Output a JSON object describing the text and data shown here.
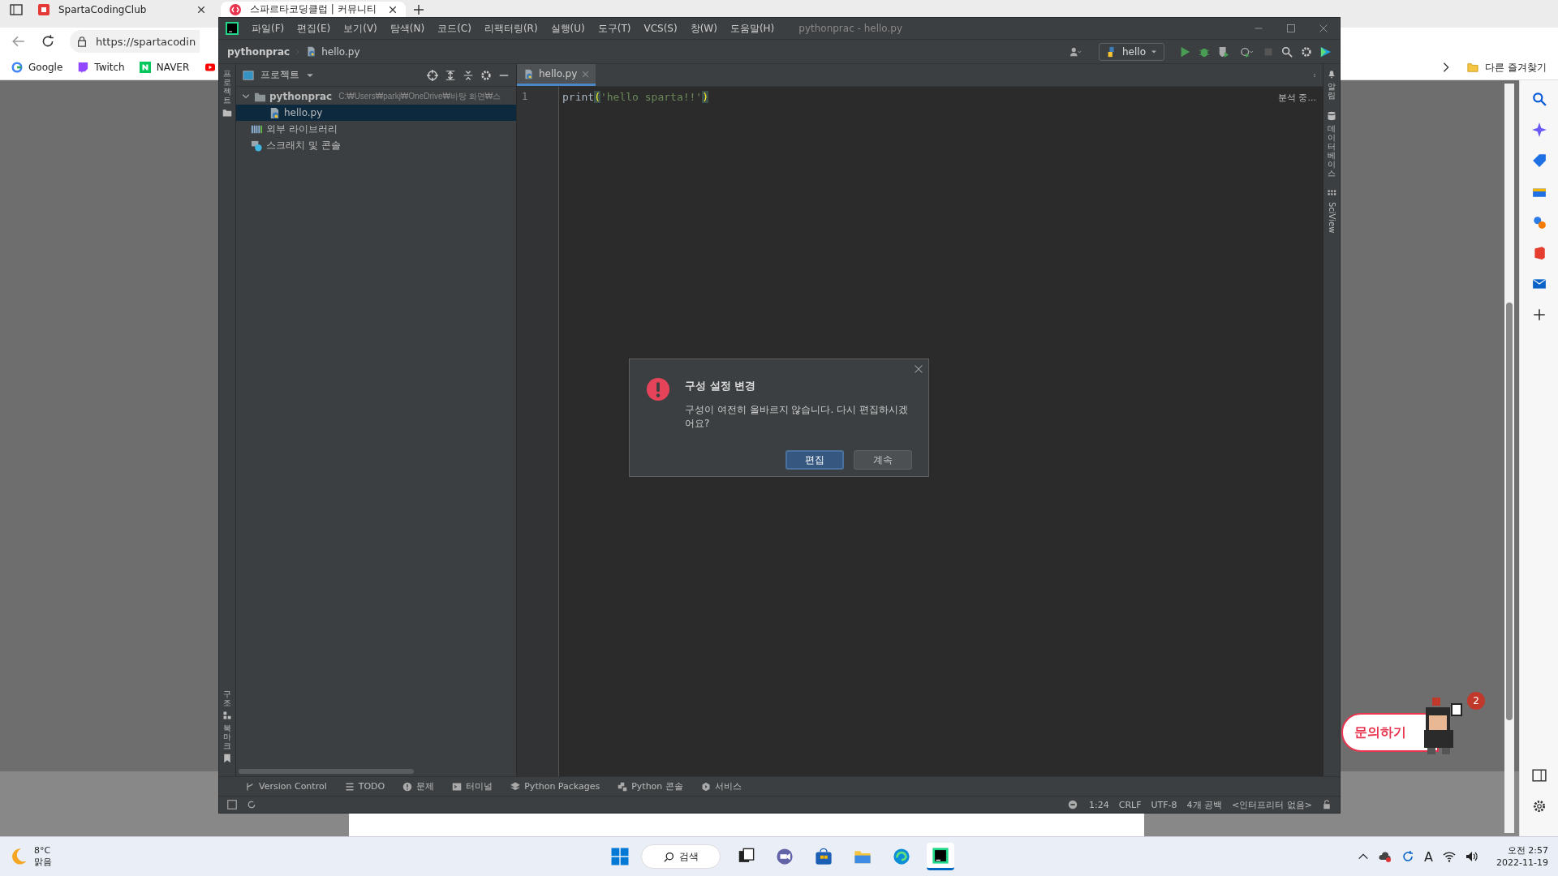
{
  "browser": {
    "tabs": [
      {
        "title": "SpartaCodingClub",
        "selected": false
      },
      {
        "title": "스파르타코딩클럽 | 커뮤니티",
        "selected": true
      }
    ],
    "address": "https://spartacodin",
    "bookmarks": [
      "Google",
      "Twitch",
      "NAVER"
    ],
    "other_favorites": "다른 즐겨찾기"
  },
  "page": {
    "inquiry_button": "문의하기",
    "badge": "2"
  },
  "ide": {
    "title": "pythonprac - hello.py",
    "menus": [
      "파일(F)",
      "편집(E)",
      "보기(V)",
      "탐색(N)",
      "코드(C)",
      "리팩터링(R)",
      "실행(U)",
      "도구(T)",
      "VCS(S)",
      "창(W)",
      "도움말(H)"
    ],
    "breadcrumb": [
      "pythonprac",
      "hello.py"
    ],
    "run_config": "hello",
    "left_strip_top": [
      "프로젝트"
    ],
    "left_strip_bottom": [
      "구조",
      "북마크"
    ],
    "right_strip": [
      {
        "kind": "korean",
        "label": "알림"
      },
      {
        "kind": "korean",
        "label": "데이터베이스"
      },
      {
        "kind": "latin",
        "label": "SciView"
      }
    ],
    "project_panel": {
      "title": "프로젝트",
      "tree": [
        {
          "kind": "folder",
          "label": "pythonprac",
          "path": "C:₩Users₩parkj₩OneDrive₩바탕 화면₩스",
          "expanded": true,
          "selected": false,
          "children": [
            {
              "kind": "python",
              "label": "hello.py",
              "selected": true
            }
          ]
        },
        {
          "kind": "library",
          "label": "외부 라이브러리",
          "selected": false
        },
        {
          "kind": "scratch",
          "label": "스크래치 및 콘솔",
          "selected": false
        }
      ]
    },
    "editor": {
      "tabs": [
        {
          "label": "hello.py",
          "selected": true
        }
      ],
      "lines": [
        {
          "number": "1",
          "tokens": [
            {
              "kind": "name",
              "text": "print"
            },
            {
              "kind": "brace",
              "text": "("
            },
            {
              "kind": "string",
              "text": "'hello sparta!!'"
            },
            {
              "kind": "brace",
              "text": ")"
            }
          ]
        }
      ],
      "status_hint": "분석 중..."
    },
    "tool_tabs": [
      {
        "kind": "vcs",
        "label": "Version Control"
      },
      {
        "kind": "todo",
        "label": "TODO"
      },
      {
        "kind": "problems",
        "label": "문제"
      },
      {
        "kind": "terminal",
        "label": "터미널"
      },
      {
        "kind": "packages",
        "label": "Python Packages"
      },
      {
        "kind": "console",
        "label": "Python 콘솔"
      },
      {
        "kind": "services",
        "label": "서비스"
      }
    ],
    "status": [
      "1:24",
      "CRLF",
      "UTF-8",
      "4개 공백",
      "<인터프리터 없음>"
    ]
  },
  "dialog": {
    "title": "구성 설정 변경",
    "message": "구성이 여전히 올바르지 않습니다. 다시 편집하시겠어요?",
    "buttons": [
      {
        "label": "편집",
        "selected": true
      },
      {
        "label": "계속",
        "selected": false
      }
    ]
  },
  "taskbar": {
    "input_indicator": "A",
    "temperature": "8°C",
    "condition": "맑음",
    "search": "검색",
    "time": "오전 2:57",
    "date": "2022-11-19"
  }
}
